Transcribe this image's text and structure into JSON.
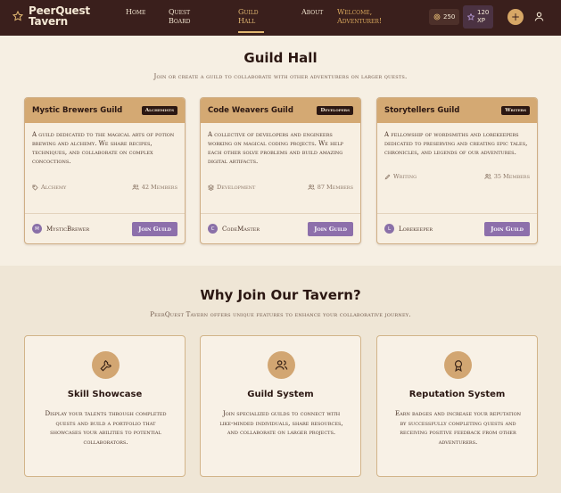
{
  "nav": {
    "brand_line1": "PeerQuest",
    "brand_line2": "Tavern",
    "links": [
      {
        "label_line1": "Home",
        "label_line2": ""
      },
      {
        "label_line1": "Quest",
        "label_line2": "Board"
      },
      {
        "label_line1": "Guild",
        "label_line2": "Hall"
      },
      {
        "label_line1": "About",
        "label_line2": ""
      }
    ],
    "welcome_line1": "Welcome,",
    "welcome_line2": "Adventurer!",
    "coins": "250",
    "xp_line1": "120",
    "xp_line2": "XP",
    "add_label": "+"
  },
  "guild_hall": {
    "title": "Guild Hall",
    "subtitle": "Join or create a guild to collaborate with other adventurers on larger quests.",
    "guilds": [
      {
        "name": "Mystic Brewers Guild",
        "tag": "Alchemists",
        "description": "A guild dedicated to the magical arts of potion brewing and alchemy. We share recipes, techniques, and collaborate on complex concoctions.",
        "category": "Alchemy",
        "members": "42 Members",
        "leader": "MysticBrewer",
        "leader_initial": "M",
        "join_label": "Join Guild"
      },
      {
        "name": "Code Weavers Guild",
        "tag": "Developers",
        "description": "A collective of developers and engineers working on magical coding projects. We help each other solve problems and build amazing digital artifacts.",
        "category": "Development",
        "members": "87 Members",
        "leader": "CodeMaster",
        "leader_initial": "C",
        "join_label": "Join Guild"
      },
      {
        "name": "Storytellers Guild",
        "tag": "Writers",
        "description": "A fellowship of wordsmiths and lorekeepers dedicated to preserving and creating epic tales, chronicles, and legends of our adventures.",
        "category": "Writing",
        "members": "35 Members",
        "leader": "Lorekeeper",
        "leader_initial": "L",
        "join_label": "Join Guild"
      }
    ]
  },
  "why_join": {
    "title": "Why Join Our Tavern?",
    "subtitle": "PeerQuest Tavern offers unique features to enhance your collaborative journey.",
    "features": [
      {
        "icon": "wrench-icon",
        "title": "Skill Showcase",
        "description": "Display your talents through completed quests and build a portfolio that showcases your abilities to potential collaborators."
      },
      {
        "icon": "users-icon",
        "title": "Guild System",
        "description": "Join specialized guilds to connect with like-minded individuals, share resources, and collaborate on larger projects."
      },
      {
        "icon": "award-icon",
        "title": "Reputation System",
        "description": "Earn badges and increase your reputation by successfully completing quests and receiving positive feedback from other adventurers."
      }
    ]
  },
  "colors": {
    "nav_bg": "#3a1f1c",
    "accent_gold": "#d4a973",
    "accent_purple": "#8d6fab",
    "page_bg": "#f6efe3"
  }
}
